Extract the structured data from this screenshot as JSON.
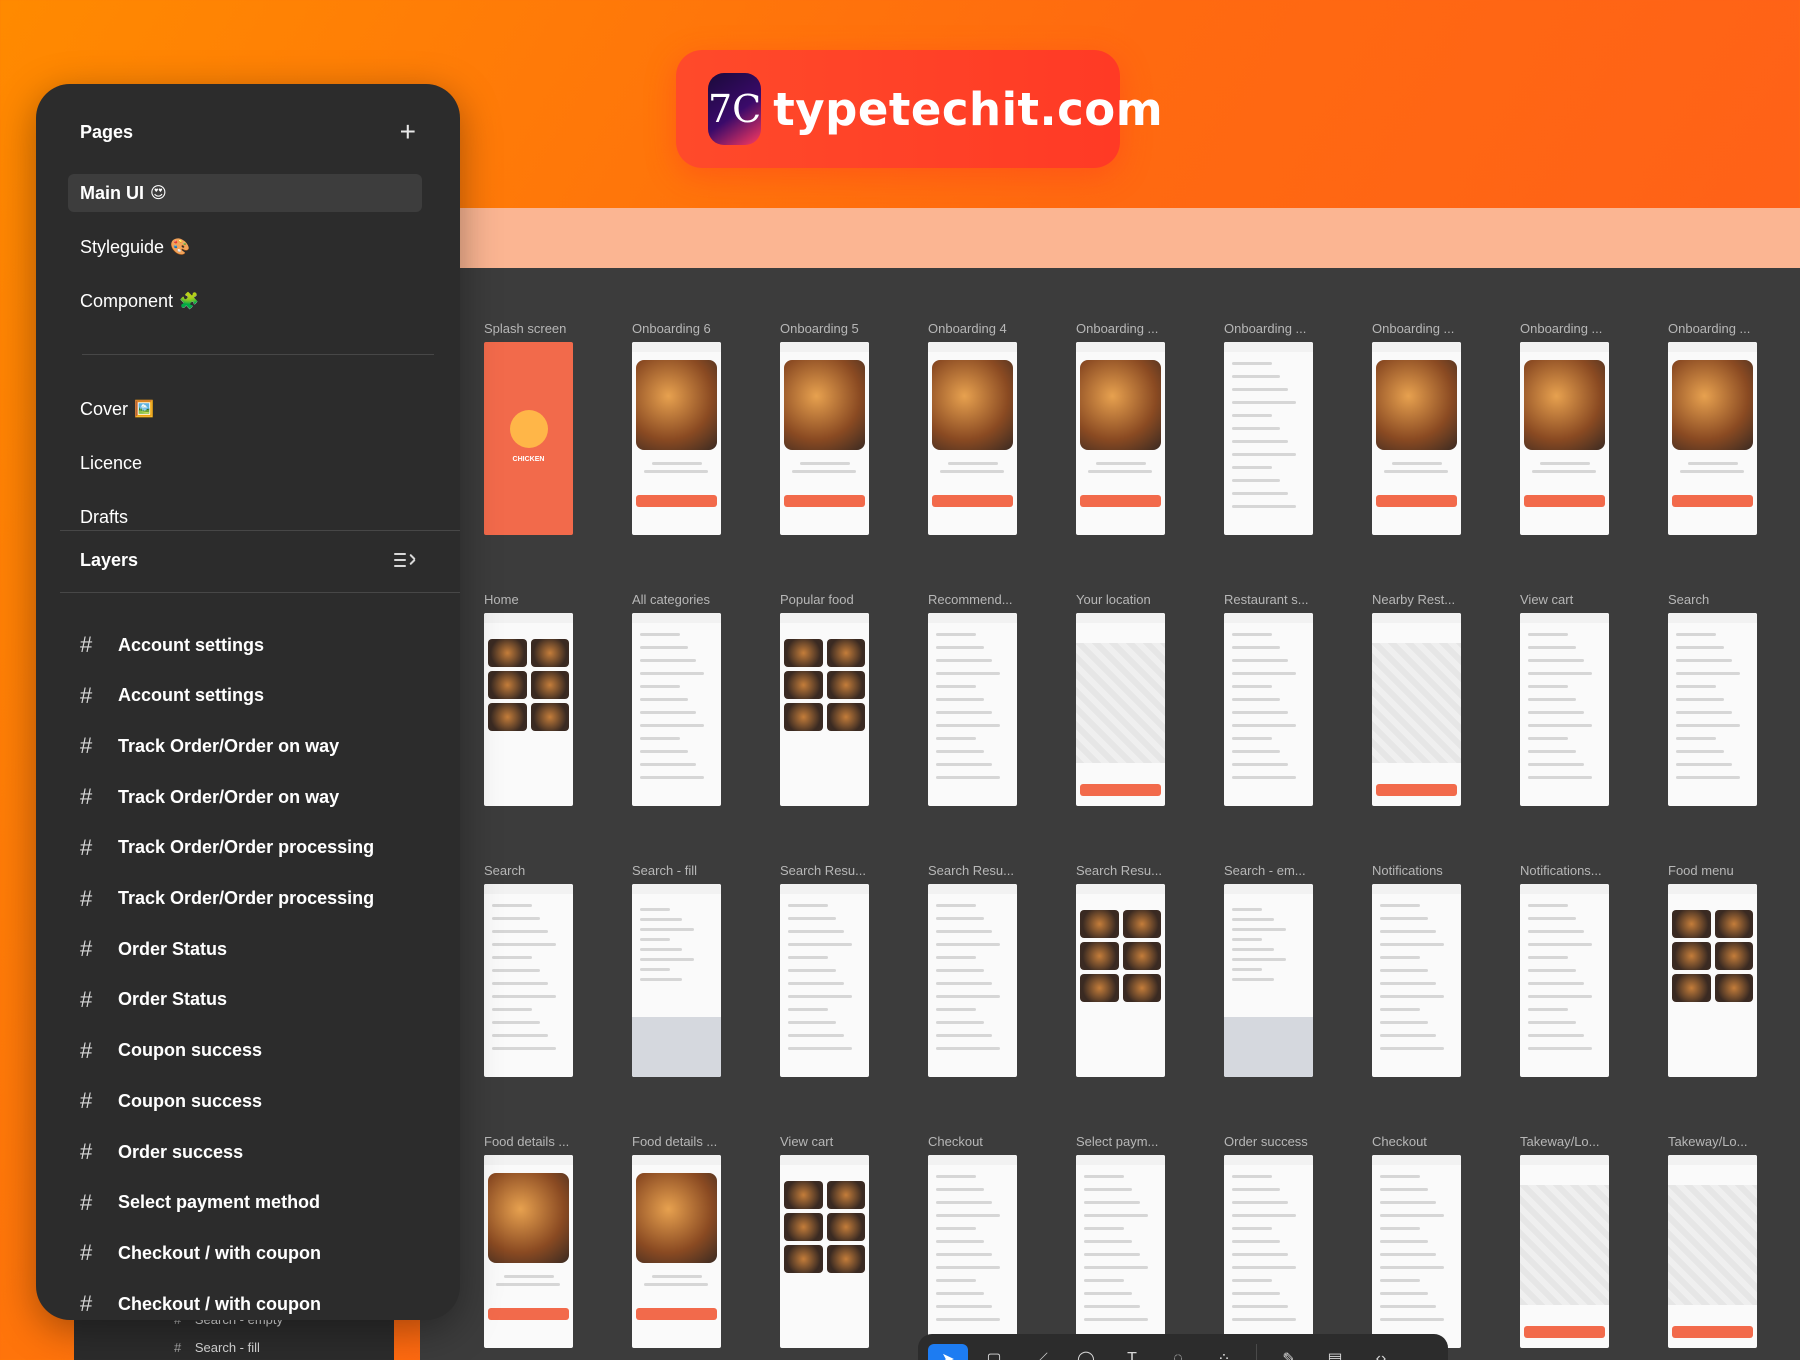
{
  "brand": {
    "text": "typetechit.com",
    "logo_glyph": "7C"
  },
  "pages": {
    "title": "Pages",
    "items": [
      {
        "label": "Main UI",
        "emoji": "😍",
        "active": true
      },
      {
        "label": "Styleguide",
        "emoji": "🎨",
        "active": false
      },
      {
        "label": "Component",
        "emoji": "🧩",
        "active": false
      },
      {
        "label": "Cover",
        "emoji": "🖼️",
        "active": false
      },
      {
        "label": "Licence",
        "emoji": "",
        "active": false
      },
      {
        "label": "Drafts",
        "emoji": "",
        "active": false
      }
    ]
  },
  "layers": {
    "title": "Layers",
    "items": [
      "Account settings",
      "Account settings",
      "Track Order/Order on way",
      "Track Order/Order on way",
      "Track Order/Order processing",
      "Track Order/Order processing",
      "Order Status",
      "Order Status",
      "Coupon success",
      "Coupon success",
      "Order success",
      "Select payment method",
      "Checkout / with coupon",
      "Checkout / with coupon"
    ],
    "below": [
      "Search - empty",
      "Search - fill"
    ]
  },
  "frames": [
    "Splash screen",
    "Onboarding 6",
    "Onboarding 5",
    "Onboarding 4",
    "Onboarding ...",
    "Onboarding ...",
    "Onboarding ...",
    "Onboarding ...",
    "Onboarding ...",
    "Home",
    "All categories",
    "Popular food",
    "Recommend...",
    "Your location",
    "Restaurant s...",
    "Nearby Rest...",
    "View cart",
    "Search",
    "Search",
    "Search - fill",
    "Search Resu...",
    "Search Resu...",
    "Search Resu...",
    "Search - em...",
    "Notifications",
    "Notifications...",
    "Food menu",
    "Food details ...",
    "Food details ...",
    "View cart",
    "Checkout",
    "Select paym...",
    "Order success",
    "Checkout",
    "Takeway/Lo...",
    "Takeway/Lo..."
  ],
  "frame_kinds": [
    "splash",
    "hero",
    "hero",
    "hero",
    "hero",
    "list",
    "hero",
    "hero",
    "hero",
    "food",
    "list",
    "food",
    "list",
    "map",
    "list",
    "map",
    "list",
    "list",
    "list",
    "keyboard",
    "list",
    "list",
    "food",
    "keyboard",
    "list",
    "list",
    "food",
    "hero",
    "hero",
    "food",
    "list",
    "list",
    "list",
    "list",
    "map",
    "map"
  ],
  "splash": {
    "brand": "CHICKEN"
  },
  "toolbar": {
    "tools": [
      "move-tool",
      "frame-tool",
      "pen-tool",
      "shape-tool",
      "text-tool",
      "comment-tool",
      "component-tool",
      "draw-tool",
      "devmode-tool",
      "code-tool"
    ],
    "glyphs": [
      "➤",
      "▢",
      "／",
      "◯",
      "T",
      "◌",
      "⁘",
      "✎",
      "▤",
      "‹›"
    ]
  },
  "colors": {
    "accent": "#f26a4b",
    "selection": "#1d7cf2",
    "panel": "#2c2c2c",
    "canvas": "#3c3c3c"
  }
}
